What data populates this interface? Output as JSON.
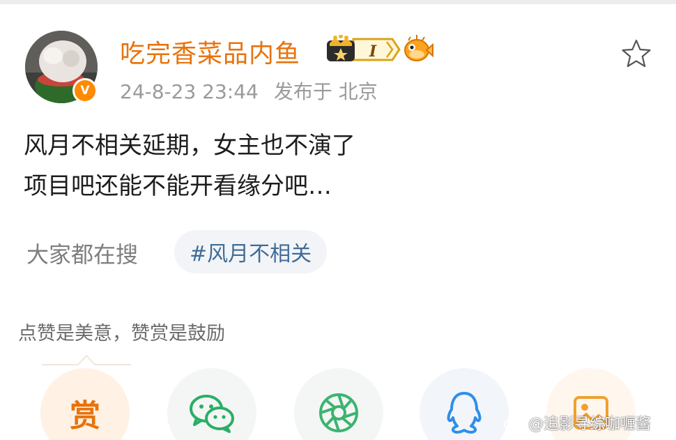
{
  "post": {
    "author": {
      "name": "吃完香菜品内鱼",
      "verified_mark": "V",
      "level_badge": "I",
      "avatar_icon": "avatar-image",
      "fan_badge_icon": "pufferfish-icon"
    },
    "time": "24-8-23 23:44",
    "location": "发布于 北京",
    "content": {
      "line1": "风月不相关延期，女主也不演了",
      "line2": "项目吧还能不能开看缘分吧…"
    },
    "favorite_icon": "star-icon"
  },
  "search": {
    "label": "大家都在搜",
    "topic": "#风月不相关"
  },
  "reward": {
    "note": "点赞是美意，赞赏是鼓励",
    "button_label": "赏"
  },
  "share_buttons": [
    {
      "name": "wechat",
      "icon": "wechat-icon"
    },
    {
      "name": "moments",
      "icon": "moments-icon"
    },
    {
      "name": "qq",
      "icon": "qq-icon"
    },
    {
      "name": "gallery",
      "icon": "gallery-icon"
    }
  ],
  "watermark": {
    "text": "@追影寻综咖喱酱",
    "icon": "weibo-icon"
  },
  "colors": {
    "username": "#e8730c",
    "verified": "#ff8a00",
    "topic": "#3f6c98",
    "meta": "#9a9a9a",
    "wechat": "#2aae67",
    "moments": "#3cb371",
    "qq": "#2f8ee8",
    "gallery": "#f0a030"
  }
}
